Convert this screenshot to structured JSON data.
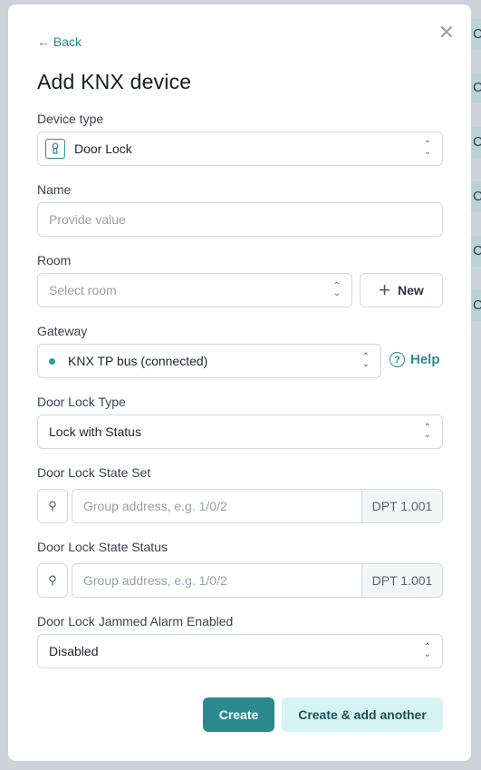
{
  "background": {
    "cells": [
      "C",
      "C",
      "C",
      "C",
      "C",
      "C"
    ]
  },
  "modal": {
    "back_label": "← Back",
    "title": "Add KNX device",
    "device_type": {
      "label": "Device type",
      "value": "Door Lock",
      "icon": "keyhole-icon"
    },
    "name": {
      "label": "Name",
      "placeholder": "Provide value"
    },
    "room": {
      "label": "Room",
      "placeholder": "Select room",
      "new_label": "New"
    },
    "gateway": {
      "label": "Gateway",
      "value": "KNX TP bus (connected)",
      "status_color": "#2a9d9a",
      "help_label": "Help"
    },
    "door_lock_type": {
      "label": "Door Lock Type",
      "value": "Lock with Status"
    },
    "state_set": {
      "label": "Door Lock State Set",
      "placeholder": "Group address, e.g. 1/0/2",
      "dpt": "DPT 1.001"
    },
    "state_status": {
      "label": "Door Lock State Status",
      "placeholder": "Group address, e.g. 1/0/2",
      "dpt": "DPT 1.001"
    },
    "jammed": {
      "label": "Door Lock Jammed Alarm Enabled",
      "value": "Disabled"
    },
    "create_label": "Create",
    "create_another_label": "Create & add another"
  },
  "colors": {
    "accent": "#2a8a8f",
    "accent_light": "#d5f3f2"
  }
}
